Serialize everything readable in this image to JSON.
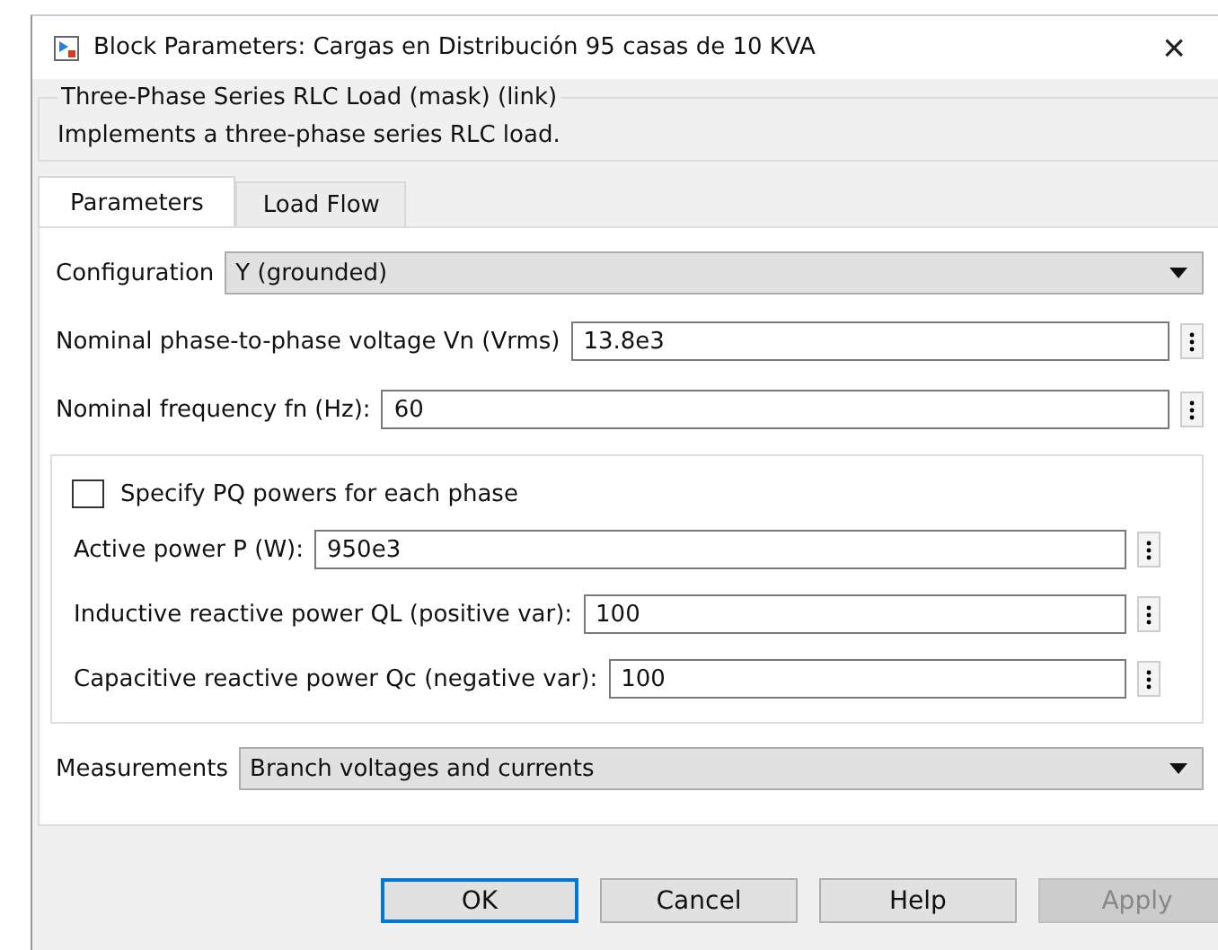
{
  "window": {
    "title": "Block Parameters: Cargas en Distribución 95 casas de 10 KVA",
    "close": "×"
  },
  "mask": {
    "title": "Three-Phase Series RLC Load (mask) (link)",
    "description": "Implements a three-phase series RLC load."
  },
  "tabs": [
    {
      "label": "Parameters",
      "selected": true
    },
    {
      "label": "Load Flow",
      "selected": false
    }
  ],
  "params": [
    {
      "kind": "dropdown",
      "label": "Configuration",
      "value": "Y (grounded)"
    },
    {
      "kind": "field",
      "label": "Nominal phase-to-phase voltage Vn (Vrms)",
      "value": "13.8e3"
    },
    {
      "kind": "field",
      "label": "Nominal frequency fn (Hz):",
      "value": "60"
    }
  ],
  "pq_group": {
    "checkbox": {
      "label": "Specify PQ powers for each phase",
      "checked": false
    },
    "fields": [
      {
        "label": "Active power P (W):",
        "value": "950e3"
      },
      {
        "label": "Inductive reactive power QL (positive var):",
        "value": "100"
      },
      {
        "label": "Capacitive reactive power Qc (negative var):",
        "value": "100"
      }
    ]
  },
  "measurements": {
    "kind": "dropdown",
    "label": "Measurements",
    "value": "Branch voltages and currents"
  },
  "buttons": [
    {
      "label": "OK",
      "default": true,
      "disabled": false
    },
    {
      "label": "Cancel",
      "default": false,
      "disabled": false
    },
    {
      "label": "Help",
      "default": false,
      "disabled": false
    },
    {
      "label": "Apply",
      "default": false,
      "disabled": true
    }
  ]
}
